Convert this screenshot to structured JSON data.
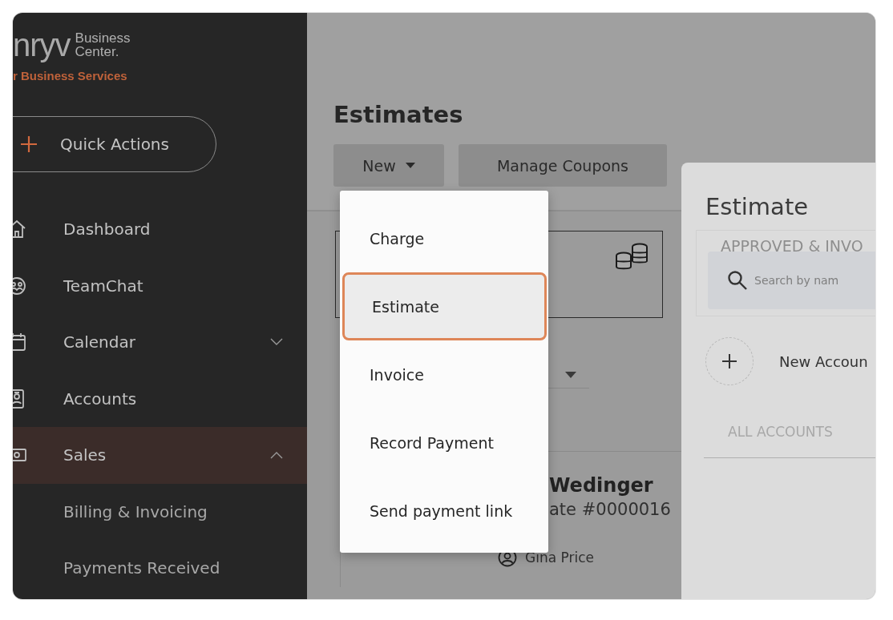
{
  "sidebar": {
    "logo": {
      "wordmark": "nryv",
      "line_1": "Business",
      "line_2": "Center.",
      "tagline": "r Business Services"
    },
    "quick_actions": {
      "label": "Quick Actions"
    },
    "items": [
      {
        "label": "Dashboard",
        "selected": false
      },
      {
        "label": "TeamChat",
        "selected": false
      },
      {
        "label": "Calendar",
        "selected": false,
        "expanded": false
      },
      {
        "label": "Accounts",
        "selected": false
      },
      {
        "label": "Sales",
        "selected": true,
        "expanded": true,
        "children": [
          {
            "label": "Billing & Invoicing"
          },
          {
            "label": "Payments Received"
          }
        ]
      }
    ]
  },
  "main": {
    "title": "Estimates",
    "buttons": [
      {
        "label": "New",
        "kind": "dropdown"
      },
      {
        "label": "Manage Coupons",
        "kind": "plain"
      }
    ],
    "dropdown_menu": {
      "items": [
        {
          "label": "Charge",
          "selected": false
        },
        {
          "label": "Estimate",
          "selected": true
        },
        {
          "label": "Invoice",
          "selected": false
        },
        {
          "label": "Record Payment",
          "selected": false
        },
        {
          "label": "Send payment link",
          "selected": false
        }
      ]
    },
    "list_entry": {
      "name": "Wedinger",
      "estimate": "ate #0000016",
      "assignee": "Gina Price"
    }
  },
  "side_panel": {
    "title": "Estimate",
    "stat_label": "APPROVED & INVO",
    "search": {
      "placeholder": "Search by nam"
    },
    "new_account": "New Accoun",
    "section": "ALL ACCOUNTS"
  }
}
